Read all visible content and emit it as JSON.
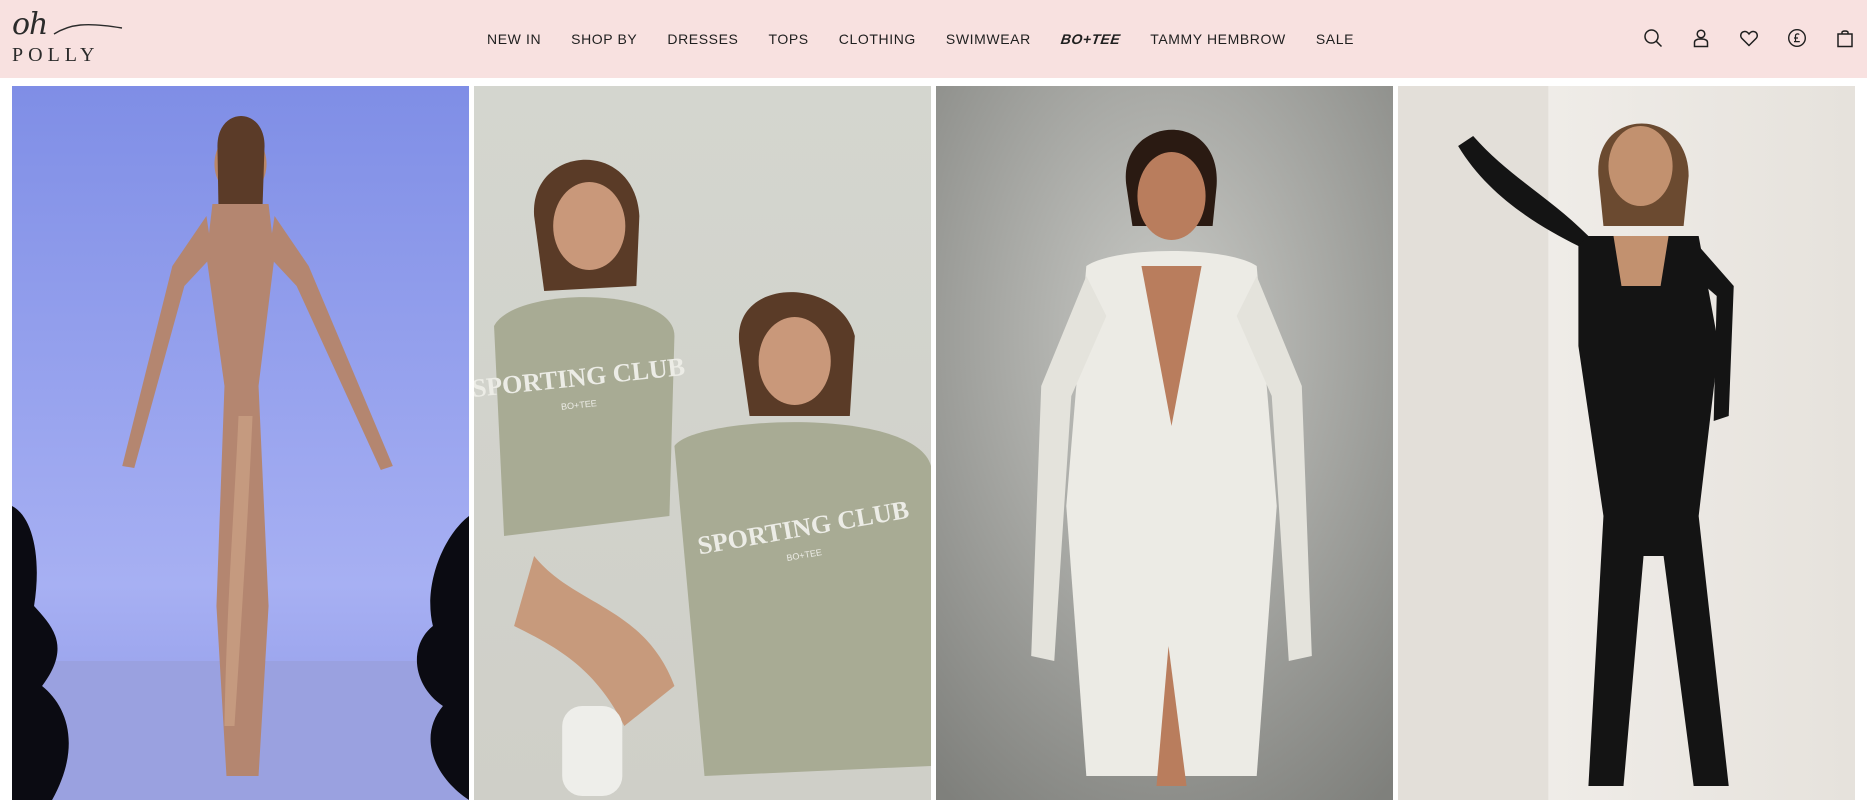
{
  "brand": {
    "logo_top": "oh",
    "logo_bottom": "POLLY"
  },
  "nav": {
    "items": [
      {
        "label": "NEW IN",
        "style": "text"
      },
      {
        "label": "SHOP BY",
        "style": "text"
      },
      {
        "label": "DRESSES",
        "style": "text"
      },
      {
        "label": "TOPS",
        "style": "text"
      },
      {
        "label": "CLOTHING",
        "style": "text"
      },
      {
        "label": "SWIMWEAR",
        "style": "text"
      },
      {
        "label": "BO+TEE",
        "style": "logo"
      },
      {
        "label": "TAMMY HEMBROW",
        "style": "text"
      },
      {
        "label": "SALE",
        "style": "text"
      }
    ]
  },
  "header_icons": [
    "search-icon",
    "account-icon",
    "wishlist-icon",
    "currency-icon",
    "bag-icon"
  ],
  "tiles": [
    {
      "image": "model-sequin-gown-photo",
      "graphic_text": ""
    },
    {
      "image": "models-sweatshirt-photo",
      "graphic_text": "SPORTING CLUB",
      "graphic_subtext": "BO+TEE"
    },
    {
      "image": "model-embellished-dress-photo",
      "graphic_text": ""
    },
    {
      "image": "model-black-jumpsuit-photo",
      "graphic_text": ""
    }
  ],
  "colors": {
    "header_bg": "#f8e1e0",
    "text": "#1f1f1f",
    "tile1_bg": "#9aa5ee",
    "tile2_bg": "#d8d8d0",
    "tile3_bg": "#9c9d99",
    "tile4_bg": "#ebe8e3"
  }
}
